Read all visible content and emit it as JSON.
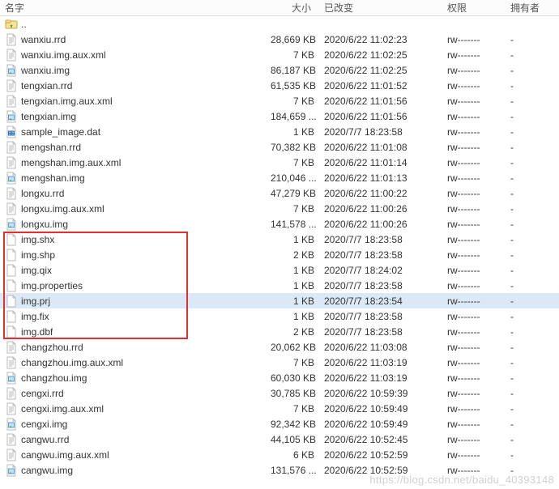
{
  "columns": {
    "name": "名字",
    "size": "大小",
    "modified": "已改变",
    "perm": "权限",
    "owner": "拥有者"
  },
  "parent_dir_icon": "folder-up-icon",
  "files": [
    {
      "icon": "file-generic",
      "name": "wanxiu.rrd",
      "size": "28,669 KB",
      "modified": "2020/6/22 11:02:23",
      "perm": "rw-------",
      "owner": "-"
    },
    {
      "icon": "file-generic",
      "name": "wanxiu.img.aux.xml",
      "size": "7 KB",
      "modified": "2020/6/22 11:02:25",
      "perm": "rw-------",
      "owner": "-"
    },
    {
      "icon": "file-image",
      "name": "wanxiu.img",
      "size": "86,187 KB",
      "modified": "2020/6/22 11:02:25",
      "perm": "rw-------",
      "owner": "-"
    },
    {
      "icon": "file-generic",
      "name": "tengxian.rrd",
      "size": "61,535 KB",
      "modified": "2020/6/22 11:01:52",
      "perm": "rw-------",
      "owner": "-"
    },
    {
      "icon": "file-generic",
      "name": "tengxian.img.aux.xml",
      "size": "7 KB",
      "modified": "2020/6/22 11:01:56",
      "perm": "rw-------",
      "owner": "-"
    },
    {
      "icon": "file-image",
      "name": "tengxian.img",
      "size": "184,659 ...",
      "modified": "2020/6/22 11:01:56",
      "perm": "rw-------",
      "owner": "-"
    },
    {
      "icon": "file-dat",
      "name": "sample_image.dat",
      "size": "1 KB",
      "modified": "2020/7/7 18:23:58",
      "perm": "rw-------",
      "owner": "-"
    },
    {
      "icon": "file-generic",
      "name": "mengshan.rrd",
      "size": "70,382 KB",
      "modified": "2020/6/22 11:01:08",
      "perm": "rw-------",
      "owner": "-"
    },
    {
      "icon": "file-generic",
      "name": "mengshan.img.aux.xml",
      "size": "7 KB",
      "modified": "2020/6/22 11:01:14",
      "perm": "rw-------",
      "owner": "-"
    },
    {
      "icon": "file-image",
      "name": "mengshan.img",
      "size": "210,046 ...",
      "modified": "2020/6/22 11:01:13",
      "perm": "rw-------",
      "owner": "-"
    },
    {
      "icon": "file-generic",
      "name": "longxu.rrd",
      "size": "47,279 KB",
      "modified": "2020/6/22 11:00:22",
      "perm": "rw-------",
      "owner": "-"
    },
    {
      "icon": "file-generic",
      "name": "longxu.img.aux.xml",
      "size": "7 KB",
      "modified": "2020/6/22 11:00:26",
      "perm": "rw-------",
      "owner": "-"
    },
    {
      "icon": "file-image",
      "name": "longxu.img",
      "size": "141,578 ...",
      "modified": "2020/6/22 11:00:26",
      "perm": "rw-------",
      "owner": "-"
    },
    {
      "icon": "file-blank",
      "name": "img.shx",
      "size": "1 KB",
      "modified": "2020/7/7 18:23:58",
      "perm": "rw-------",
      "owner": "-"
    },
    {
      "icon": "file-blank",
      "name": "img.shp",
      "size": "2 KB",
      "modified": "2020/7/7 18:23:58",
      "perm": "rw-------",
      "owner": "-"
    },
    {
      "icon": "file-blank",
      "name": "img.qix",
      "size": "1 KB",
      "modified": "2020/7/7 18:24:02",
      "perm": "rw-------",
      "owner": "-"
    },
    {
      "icon": "file-blank",
      "name": "img.properties",
      "size": "1 KB",
      "modified": "2020/7/7 18:23:58",
      "perm": "rw-------",
      "owner": "-"
    },
    {
      "icon": "file-blank",
      "name": "img.prj",
      "size": "1 KB",
      "modified": "2020/7/7 18:23:54",
      "perm": "rw-------",
      "owner": "-",
      "selected": true
    },
    {
      "icon": "file-blank",
      "name": "img.fix",
      "size": "1 KB",
      "modified": "2020/7/7 18:23:58",
      "perm": "rw-------",
      "owner": "-"
    },
    {
      "icon": "file-blank",
      "name": "img.dbf",
      "size": "2 KB",
      "modified": "2020/7/7 18:23:58",
      "perm": "rw-------",
      "owner": "-"
    },
    {
      "icon": "file-generic",
      "name": "changzhou.rrd",
      "size": "20,062 KB",
      "modified": "2020/6/22 11:03:08",
      "perm": "rw-------",
      "owner": "-"
    },
    {
      "icon": "file-generic",
      "name": "changzhou.img.aux.xml",
      "size": "7 KB",
      "modified": "2020/6/22 11:03:19",
      "perm": "rw-------",
      "owner": "-"
    },
    {
      "icon": "file-image",
      "name": "changzhou.img",
      "size": "60,030 KB",
      "modified": "2020/6/22 11:03:19",
      "perm": "rw-------",
      "owner": "-"
    },
    {
      "icon": "file-generic",
      "name": "cengxi.rrd",
      "size": "30,785 KB",
      "modified": "2020/6/22 10:59:39",
      "perm": "rw-------",
      "owner": "-"
    },
    {
      "icon": "file-generic",
      "name": "cengxi.img.aux.xml",
      "size": "7 KB",
      "modified": "2020/6/22 10:59:49",
      "perm": "rw-------",
      "owner": "-"
    },
    {
      "icon": "file-image",
      "name": "cengxi.img",
      "size": "92,342 KB",
      "modified": "2020/6/22 10:59:49",
      "perm": "rw-------",
      "owner": "-"
    },
    {
      "icon": "file-generic",
      "name": "cangwu.rrd",
      "size": "44,105 KB",
      "modified": "2020/6/22 10:52:45",
      "perm": "rw-------",
      "owner": "-"
    },
    {
      "icon": "file-generic",
      "name": "cangwu.img.aux.xml",
      "size": "6 KB",
      "modified": "2020/6/22 10:52:59",
      "perm": "rw-------",
      "owner": "-"
    },
    {
      "icon": "file-image",
      "name": "cangwu.img",
      "size": "131,576 ...",
      "modified": "2020/6/22 10:52:59",
      "perm": "rw-------",
      "owner": "-"
    }
  ],
  "highlight_box": {
    "start_index": 13,
    "end_index": 19
  },
  "watermark": "https://blog.csdn.net/baidu_40393148"
}
